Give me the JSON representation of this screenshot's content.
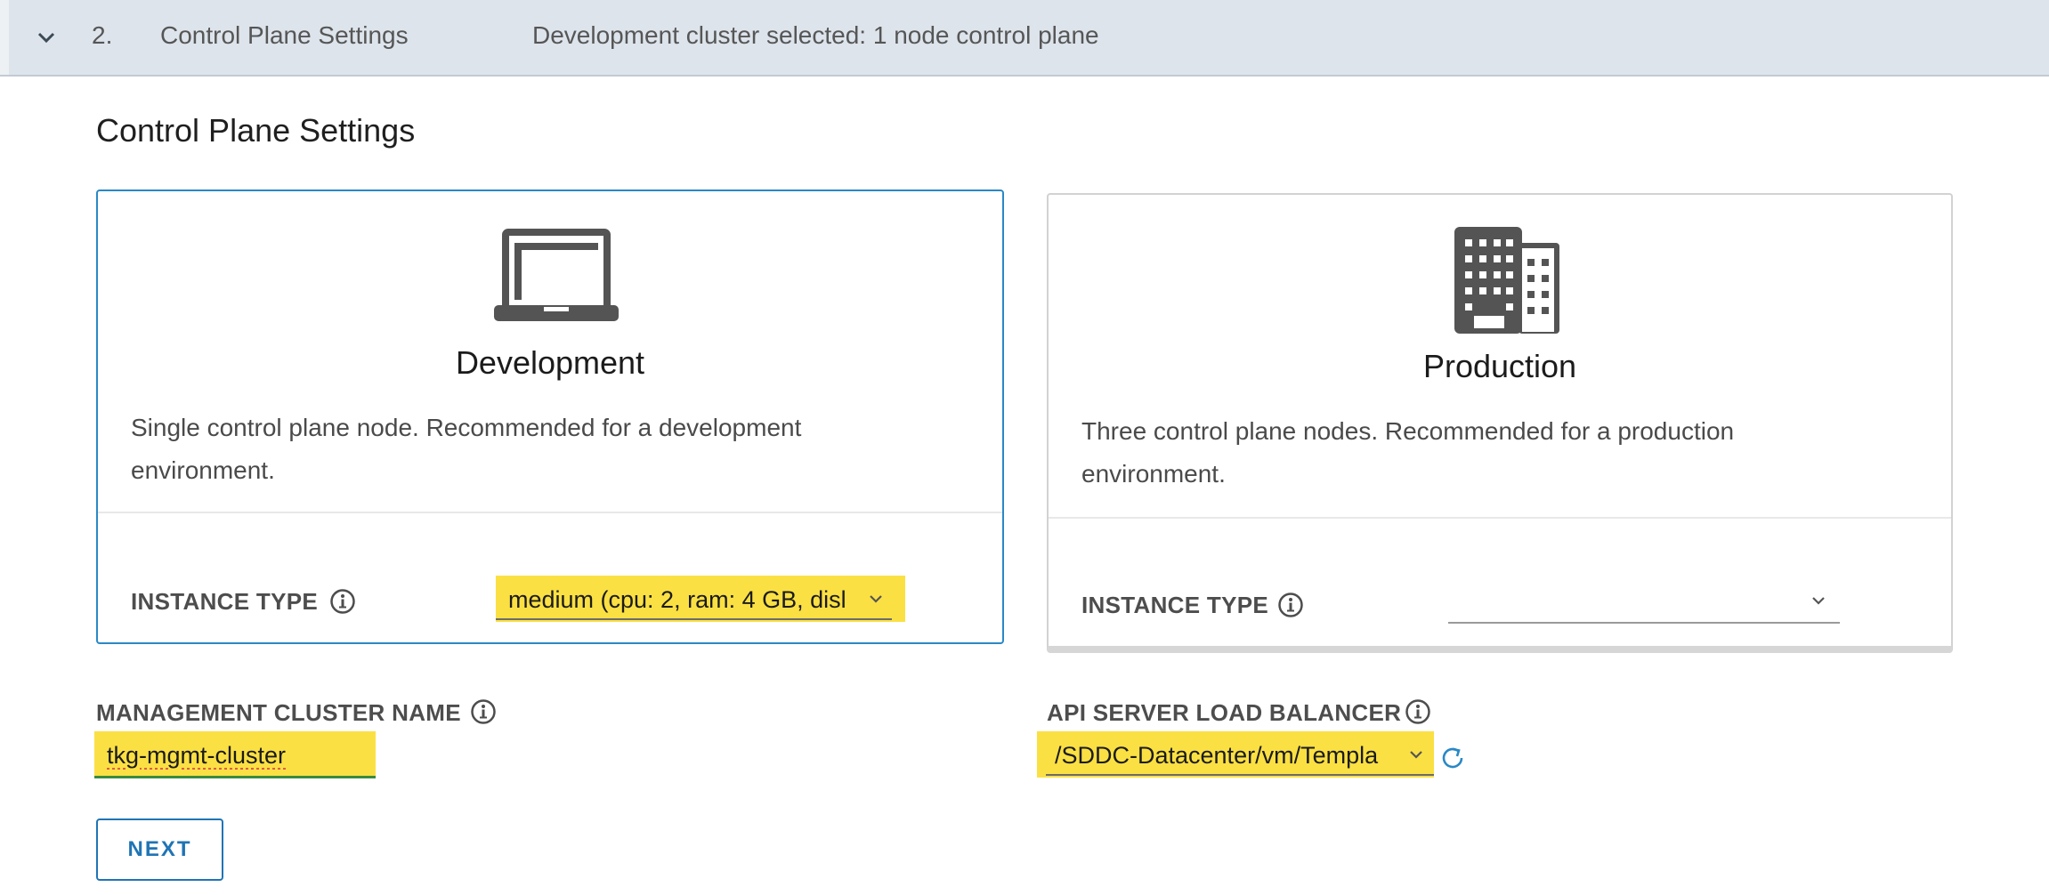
{
  "step": {
    "number": "2.",
    "title": "Control Plane Settings",
    "summary": "Development cluster selected: 1 node control plane"
  },
  "section_title": "Control Plane Settings",
  "cards": {
    "development": {
      "name": "Development",
      "description_line1": "Single control plane node. Recommended for a development",
      "description_line2": "environment.",
      "instance_type_label": "INSTANCE TYPE",
      "instance_type_value": "medium (cpu: 2, ram: 4 GB, disl",
      "icon": "laptop-icon",
      "selected": true
    },
    "production": {
      "name": "Production",
      "description_line1": "Three control plane nodes. Recommended for a production",
      "description_line2": "environment.",
      "instance_type_label": "INSTANCE TYPE",
      "instance_type_value": "",
      "icon": "building-icon",
      "selected": false
    }
  },
  "management_cluster": {
    "label": "MANAGEMENT CLUSTER NAME",
    "value": "tkg-mgmt-cluster"
  },
  "api_lb": {
    "label": "API SERVER LOAD BALANCER",
    "value": "/SDDC-Datacenter/vm/Templa"
  },
  "next_label": "NEXT",
  "colors": {
    "accent": "#1f74b5",
    "selected_border": "#2a88c6",
    "highlight": "#fbe043",
    "header_bg": "#dde4ec"
  }
}
